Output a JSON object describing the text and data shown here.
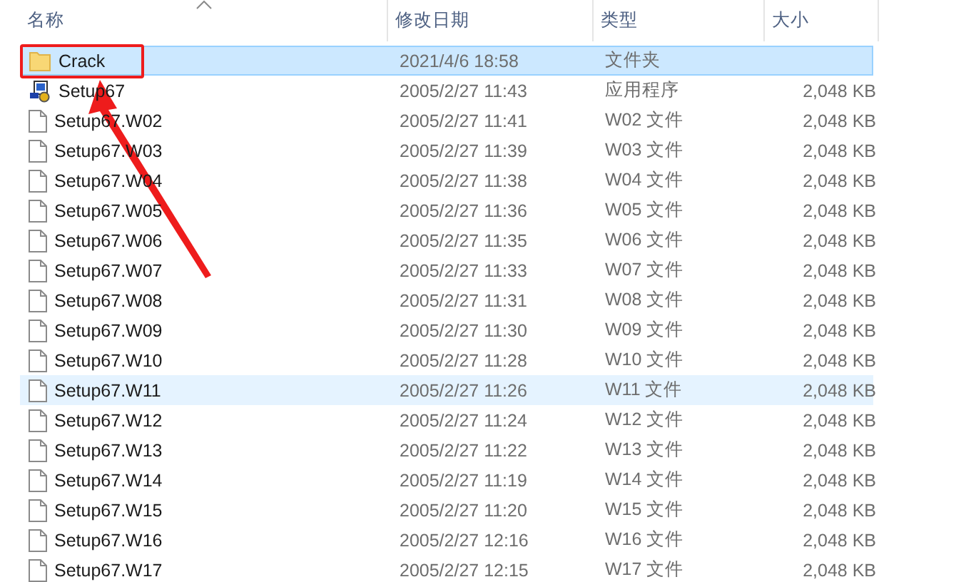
{
  "columns": [
    {
      "label": "名称",
      "sorted": true
    },
    {
      "label": "修改日期",
      "sorted": false
    },
    {
      "label": "类型",
      "sorted": false
    },
    {
      "label": "大小",
      "sorted": false
    }
  ],
  "rows": [
    {
      "kind": "folder",
      "name": "Crack",
      "date": "2021/4/6 18:58",
      "type": "文件夹",
      "selected": true,
      "hovered": false
    },
    {
      "kind": "app",
      "name": "Setup67",
      "date": "2005/2/27 11:43",
      "type": "应用程序",
      "size": "2,048 KB",
      "selected": false,
      "hovered": false
    },
    {
      "kind": "file",
      "name": "Setup67.W02",
      "date": "2005/2/27 11:41",
      "type": "W02 文件",
      "size": "2,048 KB",
      "selected": false,
      "hovered": false
    },
    {
      "kind": "file",
      "name": "Setup67.W03",
      "date": "2005/2/27 11:39",
      "type": "W03 文件",
      "size": "2,048 KB",
      "selected": false,
      "hovered": false
    },
    {
      "kind": "file",
      "name": "Setup67.W04",
      "date": "2005/2/27 11:38",
      "type": "W04 文件",
      "size": "2,048 KB",
      "selected": false,
      "hovered": false
    },
    {
      "kind": "file",
      "name": "Setup67.W05",
      "date": "2005/2/27 11:36",
      "type": "W05 文件",
      "size": "2,048 KB",
      "selected": false,
      "hovered": false
    },
    {
      "kind": "file",
      "name": "Setup67.W06",
      "date": "2005/2/27 11:35",
      "type": "W06 文件",
      "size": "2,048 KB",
      "selected": false,
      "hovered": false
    },
    {
      "kind": "file",
      "name": "Setup67.W07",
      "date": "2005/2/27 11:33",
      "type": "W07 文件",
      "size": "2,048 KB",
      "selected": false,
      "hovered": false
    },
    {
      "kind": "file",
      "name": "Setup67.W08",
      "date": "2005/2/27 11:31",
      "type": "W08 文件",
      "size": "2,048 KB",
      "selected": false,
      "hovered": false
    },
    {
      "kind": "file",
      "name": "Setup67.W09",
      "date": "2005/2/27 11:30",
      "type": "W09 文件",
      "size": "2,048 KB",
      "selected": false,
      "hovered": false
    },
    {
      "kind": "file",
      "name": "Setup67.W10",
      "date": "2005/2/27 11:28",
      "type": "W10 文件",
      "size": "2,048 KB",
      "selected": false,
      "hovered": false
    },
    {
      "kind": "file",
      "name": "Setup67.W11",
      "date": "2005/2/27 11:26",
      "type": "W11 文件",
      "size": "2,048 KB",
      "selected": false,
      "hovered": true
    },
    {
      "kind": "file",
      "name": "Setup67.W12",
      "date": "2005/2/27 11:24",
      "type": "W12 文件",
      "size": "2,048 KB",
      "selected": false,
      "hovered": false
    },
    {
      "kind": "file",
      "name": "Setup67.W13",
      "date": "2005/2/27 11:22",
      "type": "W13 文件",
      "size": "2,048 KB",
      "selected": false,
      "hovered": false
    },
    {
      "kind": "file",
      "name": "Setup67.W14",
      "date": "2005/2/27 11:19",
      "type": "W14 文件",
      "size": "2,048 KB",
      "selected": false,
      "hovered": false
    },
    {
      "kind": "file",
      "name": "Setup67.W15",
      "date": "2005/2/27 11:20",
      "type": "W15 文件",
      "size": "2,048 KB",
      "selected": false,
      "hovered": false
    },
    {
      "kind": "file",
      "name": "Setup67.W16",
      "date": "2005/2/27 12:16",
      "type": "W16 文件",
      "size": "2,048 KB",
      "selected": false,
      "hovered": false
    },
    {
      "kind": "file",
      "name": "Setup67.W17",
      "date": "2005/2/27 12:15",
      "type": "W17 文件",
      "size": "2,048 KB",
      "selected": false,
      "hovered": false
    }
  ],
  "annotation": {
    "visible": true
  }
}
